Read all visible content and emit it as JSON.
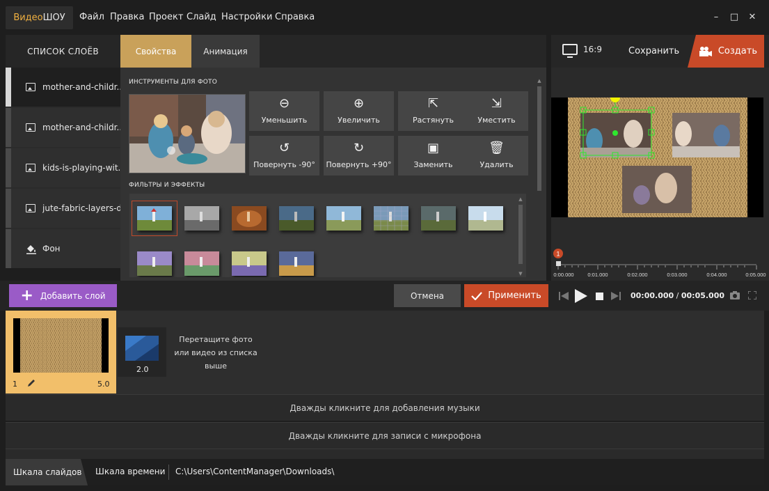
{
  "app": {
    "logo_part1": "Видео",
    "logo_part2": "ШОУ",
    "menu": [
      "Файл",
      "Правка",
      "Проект",
      "Слайд",
      "Настройки",
      "Справка"
    ],
    "window_controls": {
      "minimize": "–",
      "maximize": "□",
      "close": "✕"
    }
  },
  "layers": {
    "header": "СПИСОК СЛОЁВ",
    "items": [
      {
        "label": "mother-and-childr...",
        "icon": "image-icon",
        "active": true
      },
      {
        "label": "mother-and-childr...",
        "icon": "image-icon",
        "active": false
      },
      {
        "label": "kids-is-playing-wit...",
        "icon": "image-icon",
        "active": false
      },
      {
        "label": "jute-fabric-layers-d...",
        "icon": "image-icon",
        "active": false
      },
      {
        "label": "Фон",
        "icon": "paint-bucket-icon",
        "active": false
      }
    ],
    "add_button": "Добавить слой"
  },
  "tabs": {
    "properties": "Свойства",
    "animation": "Анимация"
  },
  "properties": {
    "photo_tools_title": "ИНСТРУМЕНТЫ ДЛЯ ФОТО",
    "tools": [
      {
        "label": "Уменьшить",
        "icon": "zoom-out-icon",
        "glyph": "⊖"
      },
      {
        "label": "Увеличить",
        "icon": "zoom-in-icon",
        "glyph": "⊕"
      },
      {
        "label": "Растянуть",
        "icon": "stretch-icon",
        "glyph": "⇱"
      },
      {
        "label": "Уместить",
        "icon": "fit-icon",
        "glyph": "⇲"
      },
      {
        "label": "Повернуть -90°",
        "icon": "rotate-left-icon",
        "glyph": "↺"
      },
      {
        "label": "Повернуть +90°",
        "icon": "rotate-right-icon",
        "glyph": "↻"
      },
      {
        "label": "Заменить",
        "icon": "replace-image-icon",
        "glyph": "▣"
      },
      {
        "label": "Удалить",
        "icon": "trash-icon",
        "glyph": "🗑"
      }
    ],
    "filters_title": "ФИЛЬТРЫ И ЭФФЕКТЫ",
    "filter_count": 12
  },
  "preview": {
    "aspect_ratio": "16:9",
    "save": "Сохранить",
    "create": "Создать",
    "marker": "1",
    "ruler_ticks": [
      "0:00.000",
      "0:01.000",
      "0:02.000",
      "0:03.000",
      "0:04.000",
      "0:05.000"
    ]
  },
  "actions": {
    "cancel": "Отмена",
    "apply": "Применить",
    "timecode_current": "00:00.000",
    "timecode_sep": " / ",
    "timecode_total": "00:05.000"
  },
  "slides": {
    "slide1_number": "1",
    "slide1_duration": "5.0",
    "transition_duration": "2.0",
    "drop_hint": "Перетащите фото или видео из списка выше"
  },
  "tracks": {
    "music": "Дважды кликните для добавления музыки",
    "mic": "Дважды кликните для записи с микрофона"
  },
  "bottom": {
    "tab_slides": "Шкала слайдов",
    "tab_time": "Шкала времени",
    "path": "C:\\Users\\ContentManager\\Downloads\\"
  },
  "colors": {
    "accent_gold": "#c9a15a",
    "accent_orange": "#c94a28",
    "accent_purple": "#9a5bc7",
    "selection_green": "#2ee82e",
    "rotate_handle": "#f2f200"
  }
}
